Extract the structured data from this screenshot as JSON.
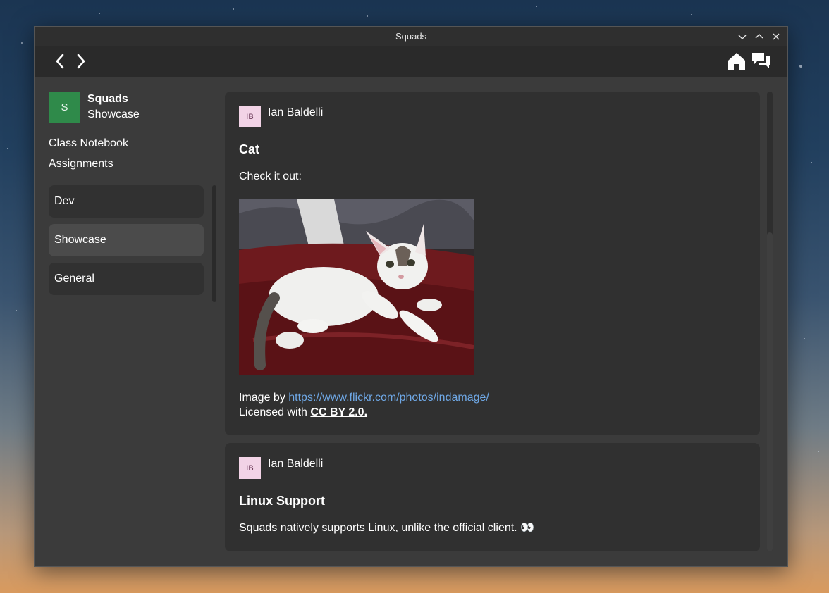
{
  "window": {
    "title": "Squads"
  },
  "toolbar": {
    "back_icon": "chevron-left-icon",
    "forward_icon": "chevron-right-icon",
    "home_icon": "home-icon",
    "chat_icon": "chat-icon"
  },
  "sidebar": {
    "team": {
      "avatar_letter": "S",
      "name": "Squads",
      "subtitle": "Showcase",
      "avatar_color": "#2f8a4a"
    },
    "links": [
      "Class Notebook",
      "Assignments"
    ],
    "channels": [
      {
        "label": "Dev",
        "active": false
      },
      {
        "label": "Showcase",
        "active": true
      },
      {
        "label": "General",
        "active": false
      }
    ]
  },
  "posts": [
    {
      "author_initials": "IB",
      "author": "Ian Baldelli",
      "title": "Cat",
      "text": "Check it out:",
      "credit_prefix": "Image by ",
      "credit_url": "https://www.flickr.com/photos/indamage/",
      "license_prefix": "Licensed with ",
      "license": "CC BY 2.0."
    },
    {
      "author_initials": "IB",
      "author": "Ian Baldelli",
      "title": "Linux Support",
      "text": "Squads natively supports Linux, unlike the official client. 👀"
    }
  ],
  "colors": {
    "link": "#6fa8e6",
    "avatar_bg": "#f2d3e6"
  }
}
